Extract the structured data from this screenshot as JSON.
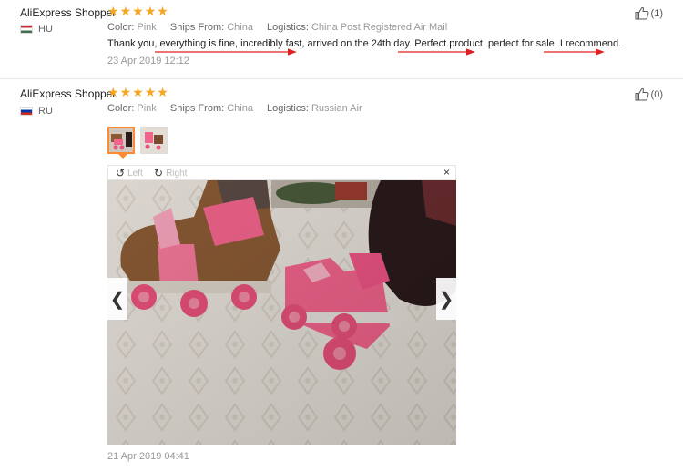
{
  "reviews": [
    {
      "user": "AliExpress Shopper",
      "country": "HU",
      "stars": 5,
      "attributes": [
        {
          "label": "Color:",
          "value": "Pink"
        },
        {
          "label": "Ships From:",
          "value": "China"
        },
        {
          "label": "Logistics:",
          "value": "China Post Registered Air Mail"
        }
      ],
      "text": "Thank you, everything is fine, incredibly fast, arrived on the 24th day. Perfect product, perfect for sale. I recommend.",
      "date": "23 Apr 2019 12:12",
      "helpful_count": "(1)"
    },
    {
      "user": "AliExpress Shopper",
      "country": "RU",
      "stars": 5,
      "attributes": [
        {
          "label": "Color:",
          "value": "Pink"
        },
        {
          "label": "Ships From:",
          "value": "China"
        },
        {
          "label": "Logistics:",
          "value": "Russian Air"
        }
      ],
      "date": "21 Apr 2019 04:41",
      "helpful_count": "(0)",
      "viewer": {
        "rotate_left": "Left",
        "rotate_right": "Right",
        "close_symbol": "×",
        "prev_symbol": "❮",
        "next_symbol": "❯"
      }
    }
  ],
  "colors": {
    "star": "#f5a623",
    "thumb_active_border": "#ff8a30",
    "annotation_red": "#e02020",
    "skate_pink": "#f2648c"
  },
  "icons": {
    "star": "★",
    "thumbs_up": "thumbs-up-icon",
    "rotate_left": "↺",
    "rotate_right": "↻"
  }
}
